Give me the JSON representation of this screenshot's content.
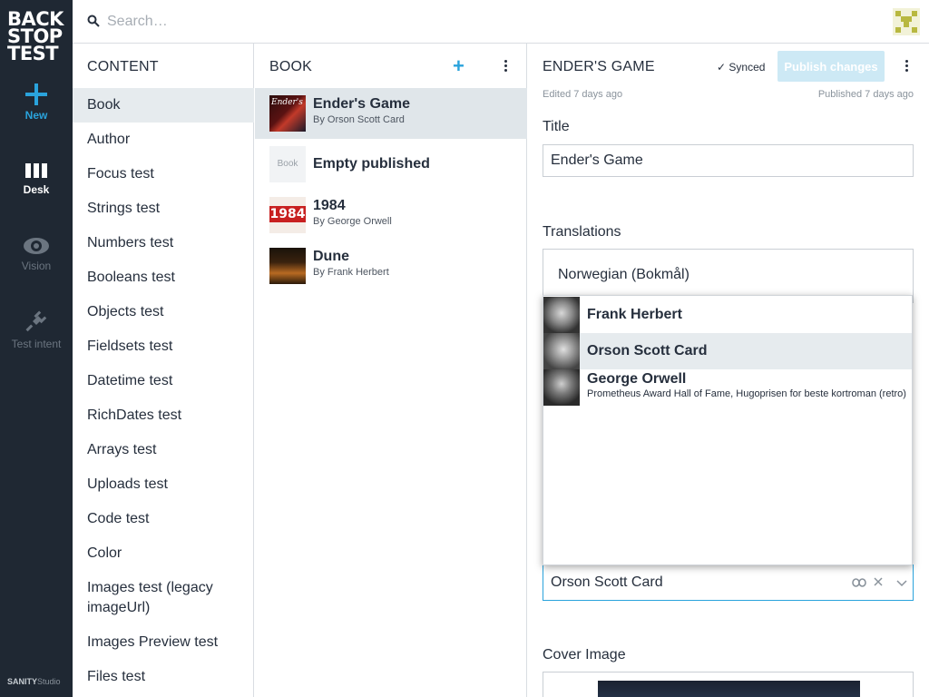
{
  "logo": {
    "line1": "BACK",
    "line2": "STOP",
    "line3": "TEST"
  },
  "leftnav": {
    "new_label": "New",
    "desk_label": "Desk",
    "vision_label": "Vision",
    "intent_label": "Test intent",
    "footer_brand": "SANITY",
    "footer_product": "Studio"
  },
  "search": {
    "placeholder": "Search…"
  },
  "content_pane": {
    "title": "CONTENT",
    "items": [
      {
        "label": "Book"
      },
      {
        "label": "Author"
      },
      {
        "label": "Focus test"
      },
      {
        "label": "Strings test"
      },
      {
        "label": "Numbers test"
      },
      {
        "label": "Booleans test"
      },
      {
        "label": "Objects test"
      },
      {
        "label": "Fieldsets test"
      },
      {
        "label": "Datetime test"
      },
      {
        "label": "RichDates test"
      },
      {
        "label": "Arrays test"
      },
      {
        "label": "Uploads test"
      },
      {
        "label": "Code test"
      },
      {
        "label": "Color"
      },
      {
        "label": "Images test (legacy imageUrl)"
      },
      {
        "label": "Images Preview test"
      },
      {
        "label": "Files test"
      }
    ]
  },
  "book_pane": {
    "title": "BOOK",
    "add_icon": "+",
    "docs": [
      {
        "title": "Ender's Game",
        "subtitle": "By Orson Scott Card"
      },
      {
        "title": "Empty published",
        "subtitle": "",
        "thumb_text": "Book"
      },
      {
        "title": "1984",
        "subtitle": "By George Orwell",
        "thumb_text": "1984"
      },
      {
        "title": "Dune",
        "subtitle": "By Frank Herbert"
      }
    ]
  },
  "editor": {
    "title": "ENDER'S GAME",
    "synced": "Synced",
    "publish_button": "Publish changes",
    "edited": "Edited 7 days ago",
    "published": "Published 7 days ago",
    "title_label": "Title",
    "title_value": "Ender's Game",
    "translations_label": "Translations",
    "translation_lang": "Norwegian (Bokmål)",
    "author_value": "Orson Scott Card",
    "cover_label": "Cover Image"
  },
  "dropdown": {
    "options": [
      {
        "name": "Frank Herbert",
        "sub": ""
      },
      {
        "name": "Orson Scott Card",
        "sub": ""
      },
      {
        "name": "George Orwell",
        "sub": "Prometheus Award Hall of Fame, Hugoprisen for beste kortroman (retro)"
      }
    ]
  },
  "colors": {
    "accent": "#2aa3dc",
    "nav_bg": "#1f2833",
    "active_row": "#e6ebee"
  }
}
